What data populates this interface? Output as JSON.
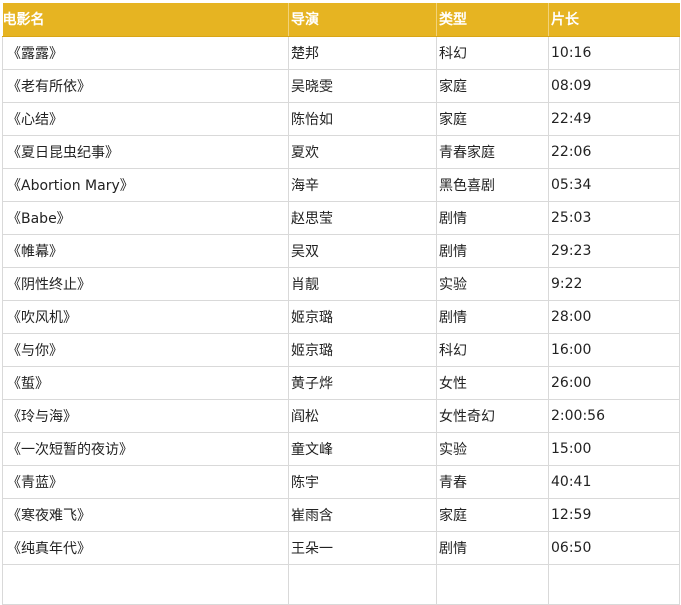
{
  "table": {
    "headers": [
      "电影名",
      "导演",
      "类型",
      "片长"
    ],
    "rows": [
      [
        "《露露》",
        "楚邦",
        "科幻",
        "10:16"
      ],
      [
        "《老有所依》",
        "吴晓雯",
        "家庭",
        "08:09"
      ],
      [
        "《心结》",
        "陈怡如",
        "家庭",
        "22:49"
      ],
      [
        "《夏日昆虫纪事》",
        "夏欢",
        "青春家庭",
        "22:06"
      ],
      [
        "《Abortion Mary》",
        "海辛",
        "黑色喜剧",
        "05:34"
      ],
      [
        "《Babe》",
        "赵思莹",
        "剧情",
        "25:03"
      ],
      [
        "《帷幕》",
        "吴双",
        "剧情",
        "29:23"
      ],
      [
        "《阴性终止》",
        "肖靓",
        "实验",
        "9:22"
      ],
      [
        "《吹风机》",
        "姬京璐",
        "剧情",
        "28:00"
      ],
      [
        "《与你》",
        "姬京璐",
        "科幻",
        "16:00"
      ],
      [
        "《蜇》",
        "黄子烨",
        "女性",
        "26:00"
      ],
      [
        "《玲与海》",
        "阎松",
        "女性奇幻",
        "2:00:56"
      ],
      [
        "《一次短暂的夜访》",
        "童文峰",
        "实验",
        "15:00"
      ],
      [
        "《青蓝》",
        "陈宇",
        "青春",
        "40:41"
      ],
      [
        "《寒夜难飞》",
        "崔雨含",
        "家庭",
        "12:59"
      ],
      [
        "《纯真年代》",
        "王朵一",
        "剧情",
        "06:50"
      ]
    ]
  },
  "colors": {
    "header_bg": "#e6b422",
    "header_text": "#ffffff",
    "grid": "#d9d9d9"
  }
}
